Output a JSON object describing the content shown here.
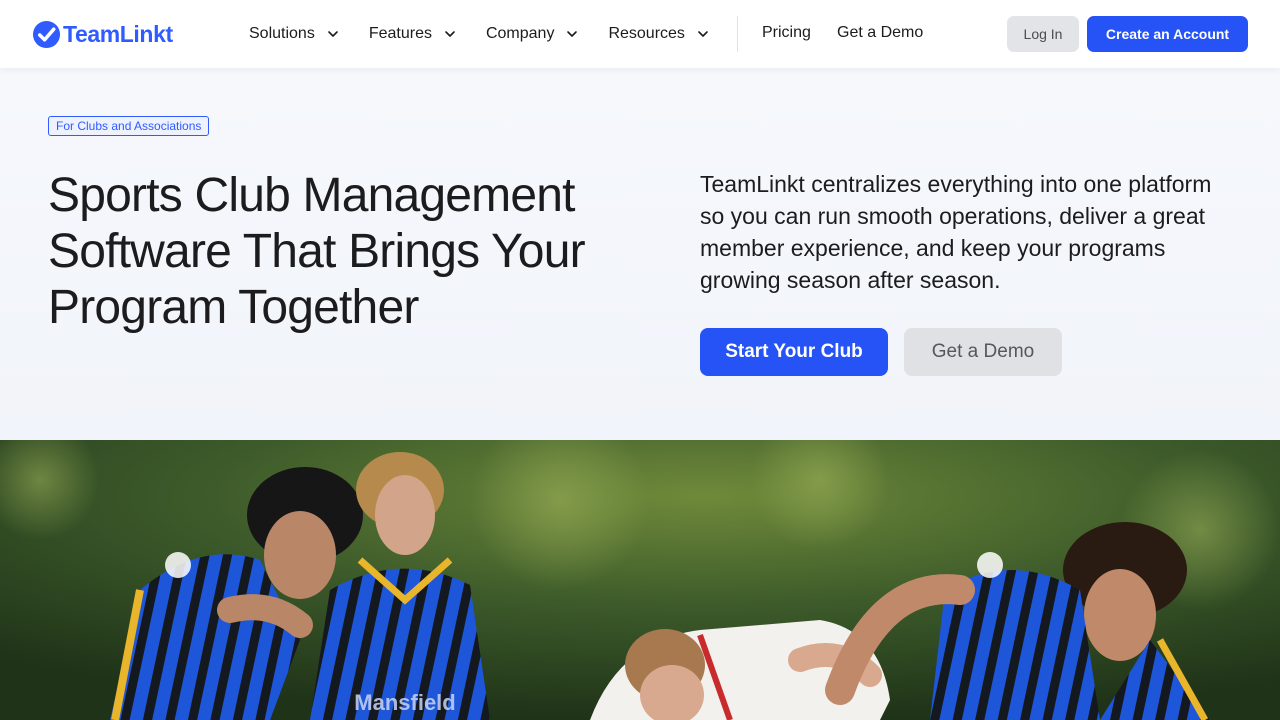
{
  "header": {
    "logo_text": "TeamLinkt",
    "logo_icon": "check-circle-icon",
    "menu": [
      {
        "label": "Solutions",
        "icon": "chevron-down-icon"
      },
      {
        "label": "Features",
        "icon": "chevron-down-icon"
      },
      {
        "label": "Company",
        "icon": "chevron-down-icon"
      },
      {
        "label": "Resources",
        "icon": "chevron-down-icon"
      }
    ],
    "links": {
      "pricing": "Pricing",
      "demo": "Get a Demo"
    },
    "login_label": "Log In",
    "create_account_label": "Create an Account"
  },
  "hero": {
    "badge": "For Clubs and Associations",
    "title": "Sports Club Management Software That Brings Your Program Together",
    "description": "TeamLinkt centralizes everything into one platform so you can run smooth operations, deliver a great member experience, and keep your programs growing season after season.",
    "primary_cta": "Start Your Club",
    "secondary_cta": "Get a Demo"
  },
  "image": {
    "subject": "soccer-players-photo",
    "jersey_text": "Mansfield"
  },
  "colors": {
    "brand_blue": "#2553f6",
    "logo_blue": "#2f5bff",
    "text_dark": "#1c1c1e",
    "button_gray": "#e0e1e4",
    "hero_background": "#f4f7fb"
  }
}
